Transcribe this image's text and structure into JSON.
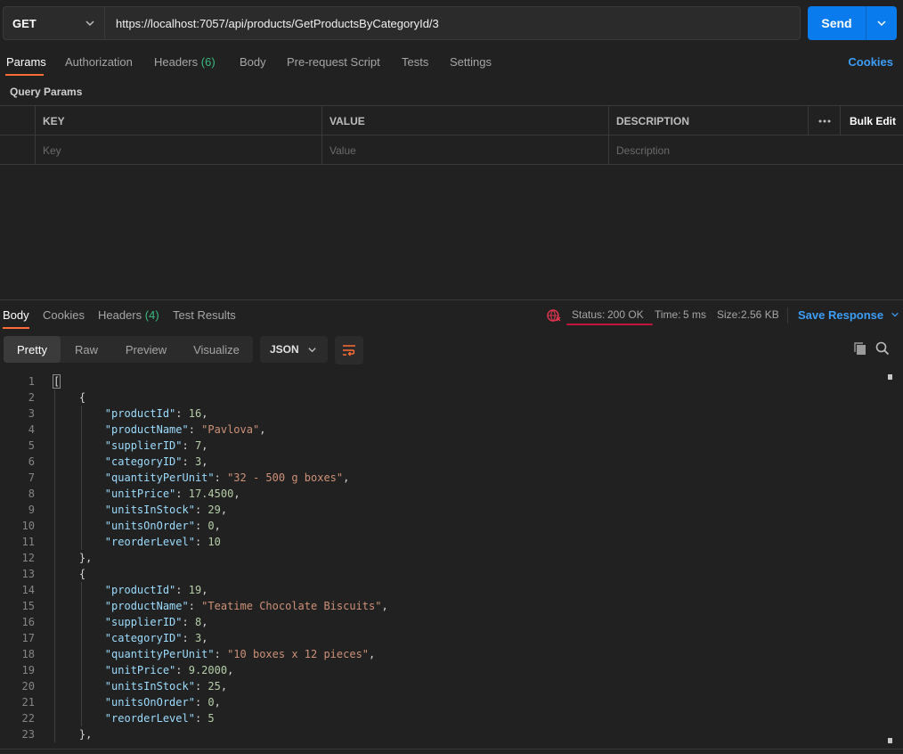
{
  "request": {
    "method": "GET",
    "url": "https://localhost:7057/api/products/GetProductsByCategoryId/3",
    "send_label": "Send"
  },
  "tabs": [
    {
      "label": "Params"
    },
    {
      "label": "Authorization"
    },
    {
      "label": "Headers",
      "count": "(6)"
    },
    {
      "label": "Body"
    },
    {
      "label": "Pre-request Script"
    },
    {
      "label": "Tests"
    },
    {
      "label": "Settings"
    }
  ],
  "cookies_label": "Cookies",
  "query_params_label": "Query Params",
  "params_table": {
    "headers": [
      "KEY",
      "VALUE",
      "DESCRIPTION"
    ],
    "bulk_edit": "Bulk Edit",
    "placeholders": [
      "Key",
      "Value",
      "Description"
    ]
  },
  "response": {
    "tabs": [
      {
        "label": "Body"
      },
      {
        "label": "Cookies"
      },
      {
        "label": "Headers",
        "count": "(4)"
      },
      {
        "label": "Test Results"
      }
    ],
    "status_label": "Status:",
    "status_value": "200 OK",
    "time_label": "Time:",
    "time_value": "5 ms",
    "size_label": "Size:",
    "size_value": "2.56 KB",
    "save_label": "Save Response",
    "view_tabs": [
      "Pretty",
      "Raw",
      "Preview",
      "Visualize"
    ],
    "format": "JSON"
  },
  "code_lines": [
    "[",
    "    {",
    "        \"productId\": 16,",
    "        \"productName\": \"Pavlova\",",
    "        \"supplierID\": 7,",
    "        \"categoryID\": 3,",
    "        \"quantityPerUnit\": \"32 - 500 g boxes\",",
    "        \"unitPrice\": 17.4500,",
    "        \"unitsInStock\": 29,",
    "        \"unitsOnOrder\": 0,",
    "        \"reorderLevel\": 10",
    "    },",
    "    {",
    "        \"productId\": 19,",
    "        \"productName\": \"Teatime Chocolate Biscuits\",",
    "        \"supplierID\": 8,",
    "        \"categoryID\": 3,",
    "        \"quantityPerUnit\": \"10 boxes x 12 pieces\",",
    "        \"unitPrice\": 9.2000,",
    "        \"unitsInStock\": 25,",
    "        \"unitsOnOrder\": 0,",
    "        \"reorderLevel\": 5",
    "    },"
  ],
  "colors": {
    "accent": "#ff6c37",
    "send": "#097bed",
    "ok": "#3cb97f",
    "link": "#3d9ef7"
  }
}
